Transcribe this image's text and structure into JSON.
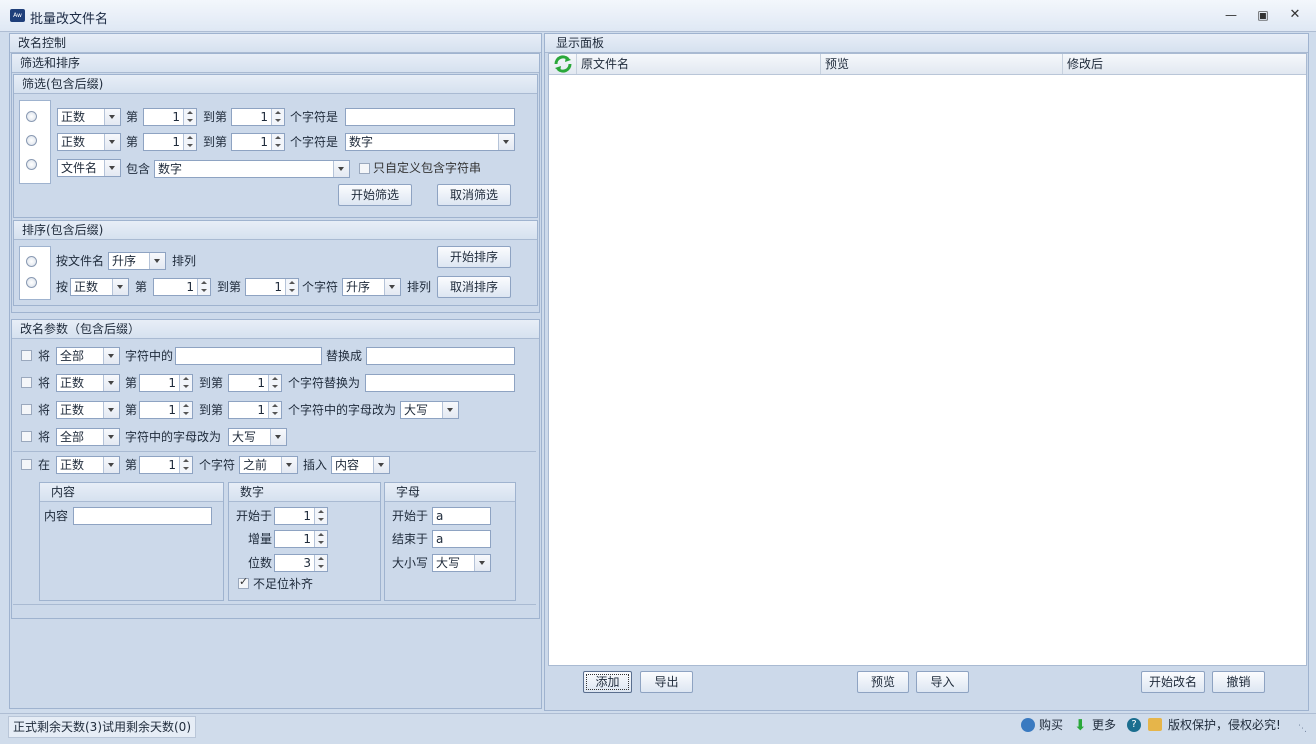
{
  "window": {
    "title": "批量改文件名",
    "icon": "app-icon",
    "controls": [
      "minimize-icon",
      "maximize-icon",
      "close-icon"
    ]
  },
  "left": {
    "title": "改名控制",
    "filter_sort_title": "筛选和排序",
    "filter": {
      "title": "筛选(包含后缀)",
      "row1": {
        "mode": "正数",
        "pre": "第",
        "from": "1",
        "to_label": "到第",
        "to": "1",
        "suffix": "个字符是",
        "value": ""
      },
      "row2": {
        "mode": "正数",
        "pre": "第",
        "from": "1",
        "to_label": "到第",
        "to": "1",
        "suffix": "个字符是",
        "value": "数字"
      },
      "row3": {
        "field": "文件名",
        "contains": "包含",
        "value": "数字",
        "custom": "只自定义包含字符串"
      },
      "start": "开始筛选",
      "cancel": "取消筛选"
    },
    "sort": {
      "title": "排序(包含后缀)",
      "row1": {
        "by": "按文件名",
        "order": "升序",
        "arrange": "排列"
      },
      "row2": {
        "by": "按",
        "mode": "正数",
        "pre": "第",
        "from": "1",
        "to_label": "到第",
        "to": "1",
        "suffix": "个字符",
        "order": "升序",
        "arrange": "排列"
      },
      "start": "开始排序",
      "cancel": "取消排序"
    },
    "rename": {
      "title": "改名参数（包含后缀）",
      "row1": {
        "jiang": "将",
        "mode": "全部",
        "mid": "字符中的",
        "value": "",
        "replace": "替换成",
        "repl": ""
      },
      "row2": {
        "jiang": "将",
        "mode": "正数",
        "pre": "第",
        "from": "1",
        "to_label": "到第",
        "to": "1",
        "suffix": "个字符替换为",
        "value": ""
      },
      "row3": {
        "jiang": "将",
        "mode": "正数",
        "pre": "第",
        "from": "1",
        "to_label": "到第",
        "to": "1",
        "suffix": "个字符中的字母改为",
        "case": "大写"
      },
      "row4": {
        "jiang": "将",
        "mode": "全部",
        "mid": "字符中的字母改为",
        "case": "大写"
      },
      "row5": {
        "zai": "在",
        "mode": "正数",
        "pre": "第",
        "pos": "1",
        "suffix": "个字符",
        "where": "之前",
        "insert": "插入",
        "what": "内容"
      },
      "content": {
        "title": "内容",
        "label": "内容",
        "value": ""
      },
      "number": {
        "title": "数字",
        "start_label": "开始于",
        "start": "1",
        "inc_label": "增量",
        "inc": "1",
        "digits_label": "位数",
        "digits": "3",
        "pad": "不足位补齐"
      },
      "letter": {
        "title": "字母",
        "start_label": "开始于",
        "start": "a",
        "end_label": "结束于",
        "end": "a",
        "case_label": "大小写",
        "case": "大写"
      }
    }
  },
  "right": {
    "title": "显示面板",
    "columns": [
      "原文件名",
      "预览",
      "修改后"
    ],
    "buttons": {
      "add": "添加",
      "export": "导出",
      "preview": "预览",
      "import": "导入",
      "start": "开始改名",
      "undo": "撤销"
    }
  },
  "status": {
    "left": "正式剩余天数(3)试用剩余天数(0)",
    "buy": "购买",
    "more": "更多",
    "rights": "版权保护，侵权必究!"
  }
}
